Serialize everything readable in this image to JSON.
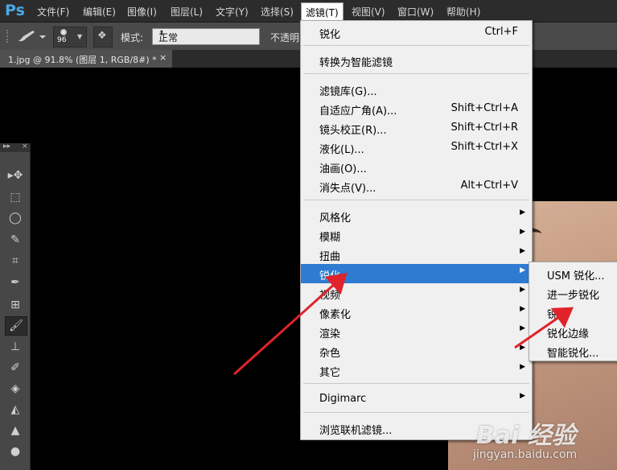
{
  "app": {
    "logo": "Ps"
  },
  "menubar": [
    {
      "label": "文件(F)"
    },
    {
      "label": "编辑(E)"
    },
    {
      "label": "图像(I)"
    },
    {
      "label": "图层(L)"
    },
    {
      "label": "文字(Y)"
    },
    {
      "label": "选择(S)"
    },
    {
      "label": "滤镜(T)",
      "active": true
    },
    {
      "label": "视图(V)"
    },
    {
      "label": "窗口(W)"
    },
    {
      "label": "帮助(H)"
    }
  ],
  "options": {
    "brush_size": "96",
    "mode_label": "模式:",
    "mode_value": "正常",
    "opacity_label": "不透明"
  },
  "document_tab": {
    "title": "1.jpg @ 91.8% (图层 1, RGB/8#) *",
    "close": "×"
  },
  "filter_menu": {
    "groups": [
      [
        {
          "label": "锐化",
          "shortcut": "Ctrl+F"
        }
      ],
      [
        {
          "label": "转换为智能滤镜",
          "shortcut": ""
        }
      ],
      [
        {
          "label": "滤镜库(G)...",
          "shortcut": ""
        },
        {
          "label": "自适应广角(A)...",
          "shortcut": "Shift+Ctrl+A"
        },
        {
          "label": "镜头校正(R)...",
          "shortcut": "Shift+Ctrl+R"
        },
        {
          "label": "液化(L)...",
          "shortcut": "Shift+Ctrl+X"
        },
        {
          "label": "油画(O)...",
          "shortcut": ""
        },
        {
          "label": "消失点(V)...",
          "shortcut": "Alt+Ctrl+V"
        }
      ],
      [
        {
          "label": "风格化",
          "submenu": true
        },
        {
          "label": "模糊",
          "submenu": true
        },
        {
          "label": "扭曲",
          "submenu": true
        },
        {
          "label": "锐化",
          "submenu": true,
          "highlighted": true
        },
        {
          "label": "视频",
          "submenu": true
        },
        {
          "label": "像素化",
          "submenu": true
        },
        {
          "label": "渲染",
          "submenu": true
        },
        {
          "label": "杂色",
          "submenu": true
        },
        {
          "label": "其它",
          "submenu": true
        }
      ],
      [
        {
          "label": "Digimarc",
          "submenu": true
        }
      ],
      [
        {
          "label": "浏览联机滤镜...",
          "shortcut": ""
        }
      ]
    ]
  },
  "sharpen_submenu": [
    {
      "label": "USM 锐化..."
    },
    {
      "label": "进一步锐化"
    },
    {
      "label": "锐化"
    },
    {
      "label": "锐化边缘"
    },
    {
      "label": "智能锐化..."
    }
  ],
  "watermark": {
    "logo": "Bai 经验",
    "url": "jingyan.baidu.com"
  },
  "colors": {
    "highlight": "#2e7bd1",
    "arrow": "#e0232a",
    "menubar": "#2c2c2c"
  }
}
